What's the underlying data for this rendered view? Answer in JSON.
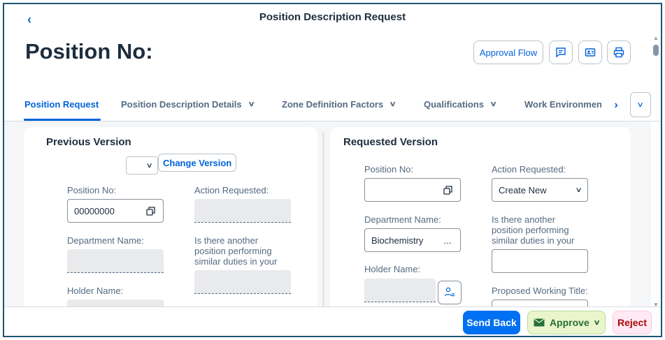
{
  "header": {
    "title": "Position Description Request",
    "object_title": "Position No:",
    "approval_flow_label": "Approval Flow"
  },
  "tabs": [
    {
      "label": "Position Request",
      "active": true
    },
    {
      "label": "Position Description Details",
      "active": false
    },
    {
      "label": "Zone Definition Factors",
      "active": false
    },
    {
      "label": "Qualifications",
      "active": false
    },
    {
      "label": "Work Environmen",
      "active": false
    }
  ],
  "previous": {
    "title": "Previous Version",
    "change_version_label": "Change Version",
    "position_no_label": "Position No:",
    "position_no_value": "00000000",
    "action_requested_label": "Action Requested:",
    "department_label": "Department Name:",
    "similar_duties_label": "Is there another position performing similar duties in your unit?:",
    "holder_label": "Holder Name:"
  },
  "requested": {
    "title": "Requested Version",
    "position_no_label": "Position No:",
    "position_no_value": "",
    "action_requested_label": "Action Requested:",
    "action_requested_value": "Create New",
    "department_label": "Department Name:",
    "department_value": "Biochemistry",
    "department_more": "...",
    "similar_duties_label": "Is there another position performing similar duties in your unit?:",
    "holder_label": "Holder Name:",
    "working_title_label": "Proposed Working Title:"
  },
  "footer": {
    "send_back_label": "Send Back",
    "approve_label": "Approve",
    "reject_label": "Reject"
  },
  "colors": {
    "accent": "#0064d9",
    "primary_button": "#0070f2",
    "approve_bg": "#ebf5cb",
    "reject_bg": "#ffeaf4",
    "frame": "#1f5673"
  }
}
